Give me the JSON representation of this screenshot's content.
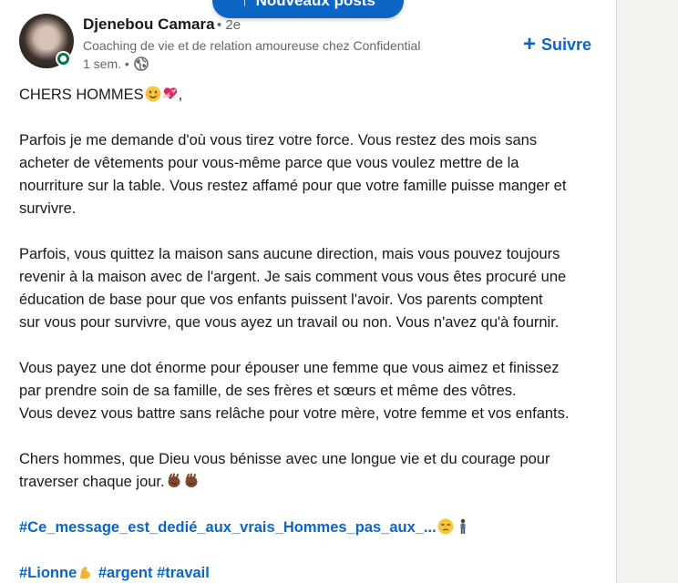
{
  "banner": {
    "arrow_glyph": "↑",
    "label": "Nouveaux posts"
  },
  "author": {
    "name": "Djenebou Camara",
    "degree": "• 2e",
    "headline": "Coaching de vie et de relation amoureuse chez Confidential",
    "time": "1 sem. •",
    "visibility_icon": "globe-icon",
    "presence_status_color": "#057642"
  },
  "follow": {
    "icon_glyph": "+",
    "label": "Suivre"
  },
  "post": {
    "greeting": "CHERS HOMMES",
    "greeting_suffix": ",",
    "p1_line1": "Parfois je me demande d'où vous tirez votre force. Vous restez des mois sans",
    "p1_line2": "acheter de vêtements pour vous-même parce que vous voulez mettre de la",
    "p1_line3": "nourriture sur la table. Vous restez affamé pour que votre famille puisse manger et",
    "p1_line4": "survivre.",
    "p2_line1": "Parfois, vous quittez la maison sans aucune direction, mais vous pouvez toujours",
    "p2_line2": "revenir à la maison avec de l'argent. Je sais comment vous vous êtes procuré une",
    "p2_line3": "éducation de base pour que vos enfants puissent l'avoir. Vos parents comptent",
    "p2_line4": "sur vous pour survivre, que vous ayez un travail ou non. Vous n'avez qu'à fournir.",
    "p3_line1": "Vous payez une dot énorme pour épouser une femme que vous aimez et finissez",
    "p3_line2": "par prendre soin de sa famille, de ses frères et sœurs et même des vôtres.",
    "p3_line3": "Vous devez vous battre sans relâche pour votre mère, votre femme et vos enfants.",
    "p4_line1": "Chers hommes, que Dieu vous bénisse avec une longue vie et du courage pour",
    "p4_line2": "traverser chaque jour.",
    "hashtag_long": "#Ce_message_est_dedié_aux_vrais_Hommes_pas_aux_...",
    "hashtag_lionne": "#Lionne",
    "hashtag_argent": "#argent",
    "hashtag_travail": "#travail"
  },
  "colors": {
    "brand": "#0a66c2",
    "muted_text": "#666666"
  }
}
